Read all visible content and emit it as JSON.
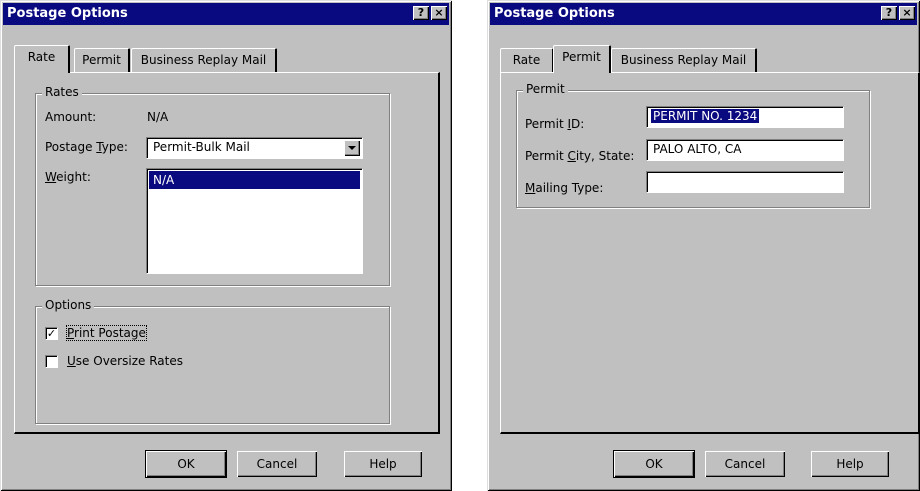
{
  "colors": {
    "titlebar": "#0a0a80",
    "face": "#c0c0c0",
    "selection": "#0a0a80"
  },
  "left_dialog": {
    "title": "Postage Options",
    "title_buttons": {
      "help": "?",
      "close": "×"
    },
    "tabs": [
      "Rate",
      "Permit",
      "Business Replay Mail"
    ],
    "active_tab": "Rate",
    "rates_group": {
      "label": "Rates",
      "amount_label": "Amount:",
      "amount_value": "N/A",
      "postage_type_label": "Postage Type:",
      "postage_type_value": "Permit-Bulk Mail",
      "weight_label": "Weight:",
      "weight_selected": "N/A"
    },
    "options_group": {
      "label": "Options",
      "print_postage_label": "Print Postage",
      "print_postage_checked": true,
      "print_postage_mark": "✓",
      "oversize_label": "Use Oversize Rates",
      "oversize_checked": false
    },
    "buttons": {
      "ok": "OK",
      "cancel": "Cancel",
      "help": "Help"
    }
  },
  "right_dialog": {
    "title": "Postage Options",
    "title_buttons": {
      "help": "?",
      "close": "×"
    },
    "tabs": [
      "Rate",
      "Permit",
      "Business Replay Mail"
    ],
    "active_tab": "Permit",
    "permit_group": {
      "label": "Permit",
      "permit_id_label": "Permit ID:",
      "permit_id_value": "PERMIT NO. 1234",
      "city_state_label": "Permit City, State:",
      "city_state_value": "PALO ALTO, CA",
      "mailing_type_label": "Mailing Type:",
      "mailing_type_value": ""
    },
    "buttons": {
      "ok": "OK",
      "cancel": "Cancel",
      "help": "Help"
    }
  }
}
